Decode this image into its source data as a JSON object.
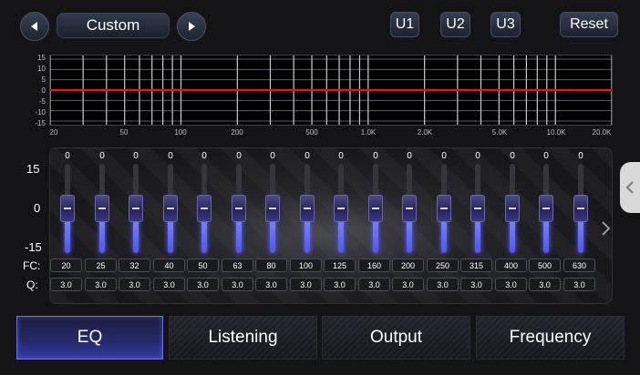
{
  "header": {
    "prev_icon": "triangle-left-icon",
    "next_icon": "triangle-right-icon",
    "preset_label": "Custom",
    "user_presets": [
      "U1",
      "U2",
      "U3"
    ],
    "reset_label": "Reset"
  },
  "graph": {
    "y_ticks": [
      "15",
      "10",
      "5",
      "0",
      "-5",
      "-10",
      "-15"
    ],
    "x_ticks": [
      "20",
      "50",
      "100",
      "200",
      "500",
      "1.0K",
      "2.0K",
      "5.0K",
      "10.0K",
      "20.0K"
    ],
    "curve_color": "#e01818"
  },
  "eq": {
    "scale": {
      "max": "15",
      "mid": "0",
      "min": "-15"
    },
    "fc_label": "FC:",
    "q_label": "Q:",
    "bands": [
      {
        "gain": "0",
        "fc": "20",
        "q": "3.0"
      },
      {
        "gain": "0",
        "fc": "25",
        "q": "3.0"
      },
      {
        "gain": "0",
        "fc": "32",
        "q": "3.0"
      },
      {
        "gain": "0",
        "fc": "40",
        "q": "3.0"
      },
      {
        "gain": "0",
        "fc": "50",
        "q": "3.0"
      },
      {
        "gain": "0",
        "fc": "63",
        "q": "3.0"
      },
      {
        "gain": "0",
        "fc": "80",
        "q": "3.0"
      },
      {
        "gain": "0",
        "fc": "100",
        "q": "3.0"
      },
      {
        "gain": "0",
        "fc": "125",
        "q": "3.0"
      },
      {
        "gain": "0",
        "fc": "160",
        "q": "3.0"
      },
      {
        "gain": "0",
        "fc": "200",
        "q": "3.0"
      },
      {
        "gain": "0",
        "fc": "250",
        "q": "3.0"
      },
      {
        "gain": "0",
        "fc": "315",
        "q": "3.0"
      },
      {
        "gain": "0",
        "fc": "400",
        "q": "3.0"
      },
      {
        "gain": "0",
        "fc": "500",
        "q": "3.0"
      },
      {
        "gain": "0",
        "fc": "630",
        "q": "3.0"
      }
    ],
    "accent_color": "#5b63ff",
    "side_tab_icon": "chevron-left-icon",
    "next_page_icon": "chevron-right-icon"
  },
  "tabs": [
    {
      "label": "EQ",
      "active": true
    },
    {
      "label": "Listening",
      "active": false
    },
    {
      "label": "Output",
      "active": false
    },
    {
      "label": "Frequency",
      "active": false
    }
  ]
}
